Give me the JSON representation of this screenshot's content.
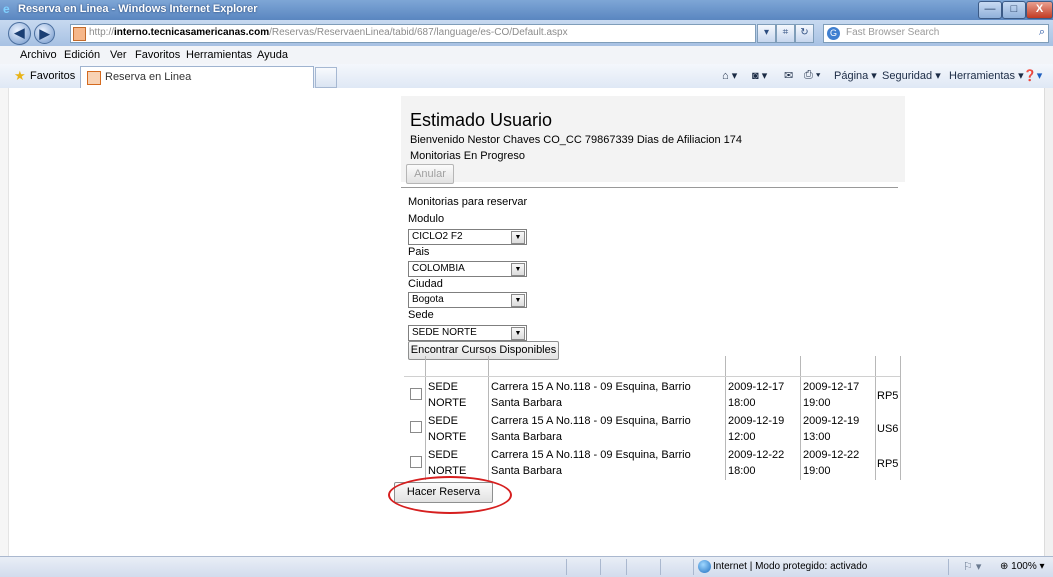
{
  "window": {
    "title": "Reserva en Linea - Windows Internet Explorer",
    "minimize": "—",
    "maximize": "□",
    "close": "X"
  },
  "address": {
    "url_prefix": "http://",
    "url_domain": "interno.tecnicasamericanas.com",
    "url_path": "/Reservas/ReservaenLinea/tabid/687/language/es-CO/Default.aspx",
    "search_placeholder": "Fast Browser Search"
  },
  "menu": [
    "Archivo",
    "Edición",
    "Ver",
    "Favoritos",
    "Herramientas",
    "Ayuda"
  ],
  "favorites": {
    "label": "Favoritos",
    "tab_label": "Reserva en Linea"
  },
  "commandbar": {
    "page": "Página ▾",
    "security": "Seguridad ▾",
    "tools": "Herramientas ▾"
  },
  "page": {
    "heading": "Estimado Usuario",
    "welcome": "Bienvenido Nestor Chaves CO_CC 79867339 Dias de Afiliacion 174",
    "in_progress": "Monitorias En Progreso",
    "cancel_button": "Anular",
    "to_reserve": "Monitorias para reservar",
    "module_label": "Modulo",
    "module_value": "CICLO2 F2",
    "country_label": "Pais",
    "country_value": "COLOMBIA",
    "city_label": "Ciudad",
    "city_value": "Bogota",
    "site_label": "Sede",
    "site_value": "SEDE NORTE",
    "find_button": "Encontrar Cursos Disponibles",
    "reserve_button": "Hacer Reserva"
  },
  "results": [
    {
      "sede": "SEDE NORTE",
      "address": "Carrera 15 A No.118 - 09 Esquina, Barrio Santa Barbara",
      "start_date": "2009-12-17",
      "start_time": "18:00",
      "end_date": "2009-12-17",
      "end_time": "19:00",
      "code": "RP5"
    },
    {
      "sede": "SEDE NORTE",
      "address": "Carrera 15 A No.118 - 09 Esquina, Barrio Santa Barbara",
      "start_date": "2009-12-19",
      "start_time": "12:00",
      "end_date": "2009-12-19",
      "end_time": "13:00",
      "code": "US6"
    },
    {
      "sede": "SEDE NORTE",
      "address": "Carrera 15 A No.118 - 09 Esquina, Barrio Santa Barbara",
      "start_date": "2009-12-22",
      "start_time": "18:00",
      "end_date": "2009-12-22",
      "end_time": "19:00",
      "code": "RP5"
    }
  ],
  "statusbar": {
    "zone": "Internet | Modo protegido: activado",
    "zoom": "100%"
  },
  "colors": {
    "highlight_oval": "#d61f1f",
    "titlebar": "#5a86c0"
  },
  "icons": [
    "ie-icon",
    "back-icon",
    "forward-icon",
    "page-icon",
    "refresh-icon",
    "stop-icon",
    "search-icon",
    "favorites-star-icon",
    "home-icon",
    "feeds-icon",
    "mail-icon",
    "print-icon",
    "help-icon",
    "globe-icon"
  ]
}
